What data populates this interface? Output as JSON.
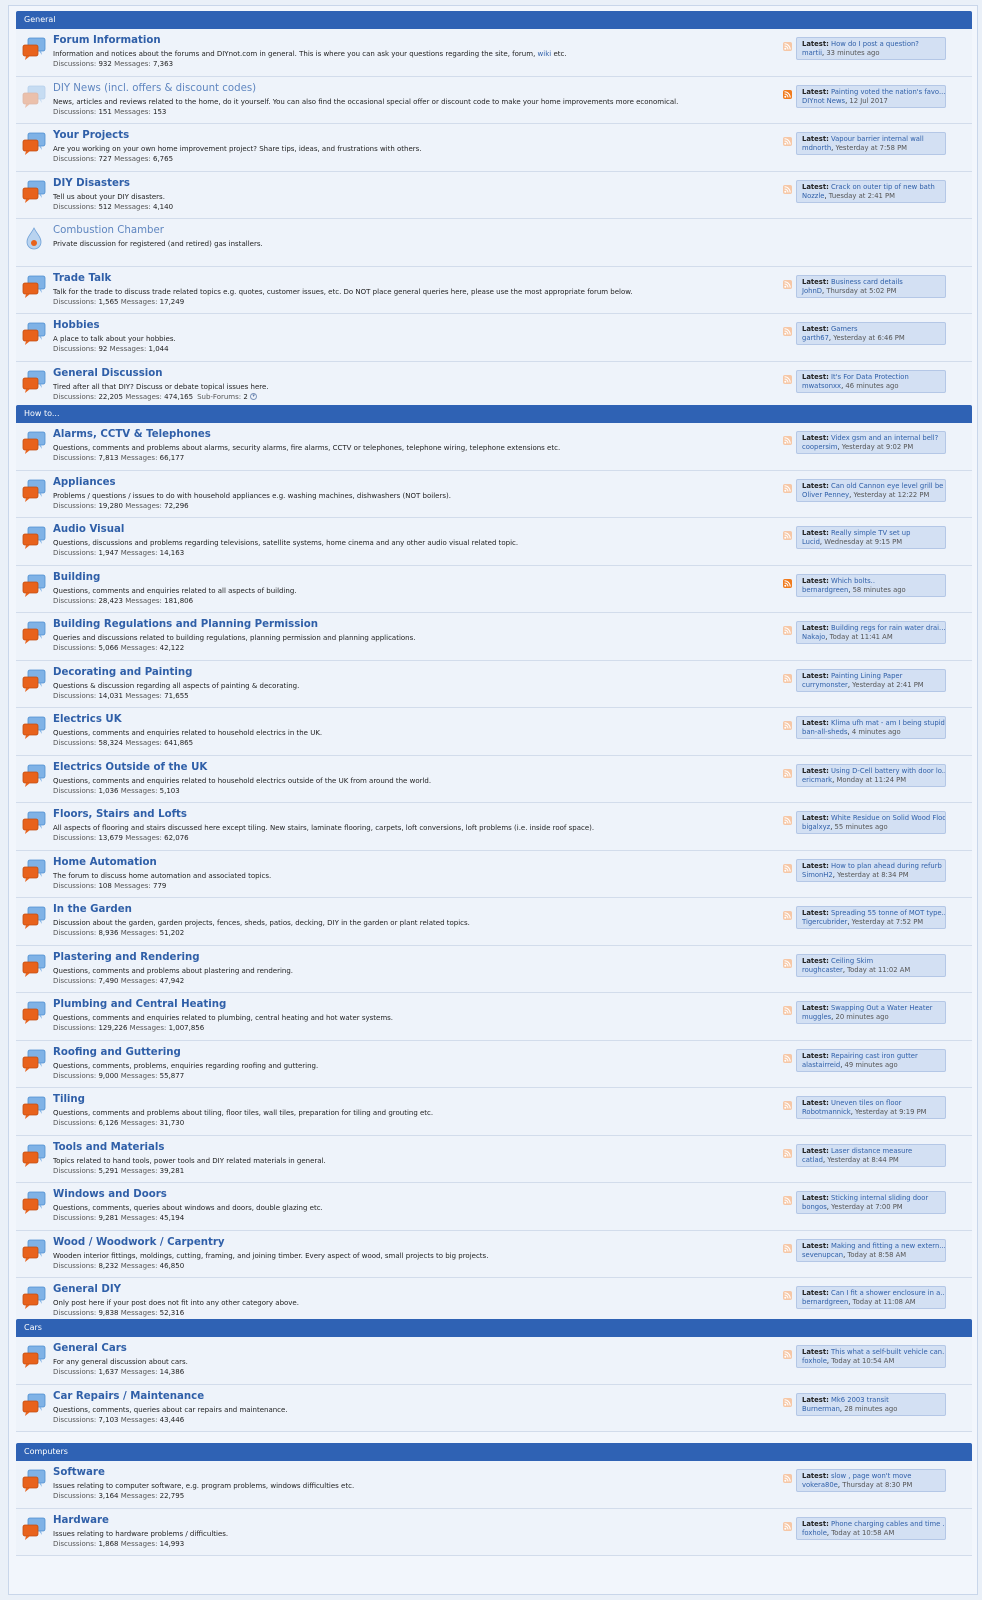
{
  "latest_label": "Latest:",
  "discussions_label": "Discussions:",
  "messages_label": "Messages:",
  "subforums_label": "Sub-Forums:",
  "colors": {
    "header_bg": "#2f62b4",
    "link": "#2f5fa8",
    "icon_orange": "#e8621c",
    "icon_blue": "#5b9bd9",
    "rss_active": "#f07b1e"
  },
  "categories": [
    {
      "title": "General",
      "forums": [
        {
          "title": "Forum Information",
          "desc": "Information and notices about the forums and DIYnot.com in general. This is where you can ask your questions regarding the site, forum,",
          "desc_link": "wiki",
          "desc_after": "etc.",
          "discussions": "932",
          "messages": "7,363",
          "latest_title": "How do I post a question?",
          "latest_user": "martii",
          "latest_time": "33 minutes ago",
          "icon": "chat",
          "rss": "inactive"
        },
        {
          "title": "DIY News (incl. offers & discount codes)",
          "desc": "News, articles and reviews related to the home, do it yourself. You can also find the occasional special offer or discount code to make your home improvements more economical.",
          "discussions": "151",
          "messages": "153",
          "latest_title": "Painting voted the nation's favo...",
          "latest_user": "DIYnot News",
          "latest_time": "12 Jul 2017",
          "icon": "chat-faded",
          "rss": "active",
          "dim": true
        },
        {
          "title": "Your Projects",
          "desc": "Are you working on your own home improvement project? Share tips, ideas, and frustrations with others.",
          "discussions": "727",
          "messages": "6,765",
          "latest_title": "Vapour barrier internal wall",
          "latest_user": "mdnorth",
          "latest_time": "Yesterday at 7:58 PM",
          "icon": "chat",
          "rss": "inactive"
        },
        {
          "title": "DIY Disasters",
          "desc": "Tell us about your DIY disasters.",
          "discussions": "512",
          "messages": "4,140",
          "latest_title": "Crack on outer tip of new bath",
          "latest_user": "Nozzle",
          "latest_time": "Tuesday at 2:41 PM",
          "icon": "chat",
          "rss": "inactive"
        },
        {
          "title": "Combustion Chamber",
          "desc": "Private discussion for registered (and retired) gas installers.",
          "icon": "flame",
          "dim": true,
          "no_stats": true
        },
        {
          "title": "Trade Talk",
          "desc": "Talk for the trade to discuss trade related topics e.g. quotes, customer issues, etc. Do NOT place general queries here, please use the most appropriate forum below.",
          "discussions": "1,565",
          "messages": "17,249",
          "latest_title": "Business card details",
          "latest_user": "JohnD",
          "latest_time": "Thursday at 5:02 PM",
          "icon": "chat",
          "rss": "inactive"
        },
        {
          "title": "Hobbies",
          "desc": "A place to talk about your hobbies.",
          "discussions": "92",
          "messages": "1,044",
          "latest_title": "Gamers",
          "latest_user": "garth67",
          "latest_time": "Yesterday at 6:46 PM",
          "icon": "chat",
          "rss": "inactive"
        },
        {
          "title": "General Discussion",
          "desc": "Tired after all that DIY? Discuss or debate topical issues here.",
          "discussions": "22,205",
          "messages": "474,165",
          "subforums": "2",
          "latest_title": "It's For Data Protection",
          "latest_user": "mwatsonxx",
          "latest_time": "46 minutes ago",
          "icon": "chat",
          "rss": "inactive"
        }
      ]
    },
    {
      "title": "How to...",
      "forums": [
        {
          "title": "Alarms, CCTV & Telephones",
          "desc": "Questions, comments and problems about alarms, security alarms, fire alarms, CCTV or telephones, telephone wiring, telephone extensions etc.",
          "discussions": "7,813",
          "messages": "66,177",
          "latest_title": "Videx gsm and an internal bell?",
          "latest_user": "coopersim",
          "latest_time": "Yesterday at 9:02 PM",
          "icon": "chat",
          "rss": "inactive"
        },
        {
          "title": "Appliances",
          "desc": "Problems / questions / issues to do with household appliances e.g. washing machines, dishwashers (NOT boilers).",
          "discussions": "19,280",
          "messages": "72,296",
          "latest_title": "Can old Cannon eye level grill be ...",
          "latest_user": "Oliver Penney",
          "latest_time": "Yesterday at 12:22 PM",
          "icon": "chat",
          "rss": "inactive"
        },
        {
          "title": "Audio Visual",
          "desc": "Questions, discussions and problems regarding televisions, satellite systems, home cinema and any other audio visual related topic.",
          "discussions": "1,947",
          "messages": "14,163",
          "latest_title": "Really simple TV set up",
          "latest_user": "Lucid",
          "latest_time": "Wednesday at 9:15 PM",
          "icon": "chat",
          "rss": "inactive"
        },
        {
          "title": "Building",
          "desc": "Questions, comments and enquiries related to all aspects of building.",
          "discussions": "28,423",
          "messages": "181,806",
          "latest_title": "Which bolts..",
          "latest_user": "bernardgreen",
          "latest_time": "58 minutes ago",
          "icon": "chat",
          "rss": "active"
        },
        {
          "title": "Building Regulations and Planning Permission",
          "desc": "Queries and discussions related to building regulations, planning permission and planning applications.",
          "discussions": "5,066",
          "messages": "42,122",
          "latest_title": "Building regs for rain water drai...",
          "latest_user": "Nakajo",
          "latest_time": "Today at 11:41 AM",
          "icon": "chat",
          "rss": "inactive"
        },
        {
          "title": "Decorating and Painting",
          "desc": "Questions & discussion regarding all aspects of painting & decorating.",
          "discussions": "14,031",
          "messages": "71,655",
          "latest_title": "Painting Lining Paper",
          "latest_user": "currymonster",
          "latest_time": "Yesterday at 2:41 PM",
          "icon": "chat",
          "rss": "inactive"
        },
        {
          "title": "Electrics UK",
          "desc": "Questions, comments and enquiries related to household electrics in the UK.",
          "discussions": "58,324",
          "messages": "641,865",
          "latest_title": "Klima ufh mat - am I being stupid...",
          "latest_user": "ban-all-sheds",
          "latest_time": "4 minutes ago",
          "icon": "chat",
          "rss": "inactive"
        },
        {
          "title": "Electrics Outside of the UK",
          "desc": "Questions, comments and enquiries related to household electrics outside of the UK from around the world.",
          "discussions": "1,036",
          "messages": "5,103",
          "latest_title": "Using D-Cell battery with door lo...",
          "latest_user": "ericmark",
          "latest_time": "Monday at 11:24 PM",
          "icon": "chat",
          "rss": "inactive"
        },
        {
          "title": "Floors, Stairs and Lofts",
          "desc": "All aspects of flooring and stairs discussed here except tiling. New stairs, laminate flooring, carpets, loft conversions, loft problems (i.e. inside roof space).",
          "discussions": "13,679",
          "messages": "62,076",
          "latest_title": "White Residue on Solid Wood Floor",
          "latest_user": "bigalxyz",
          "latest_time": "55 minutes ago",
          "icon": "chat",
          "rss": "inactive"
        },
        {
          "title": "Home Automation",
          "desc": "The forum to discuss home automation and associated topics.",
          "discussions": "108",
          "messages": "779",
          "latest_title": "How to plan ahead during refurb",
          "latest_user": "SimonH2",
          "latest_time": "Yesterday at 8:34 PM",
          "icon": "chat",
          "rss": "inactive"
        },
        {
          "title": "In the Garden",
          "desc": "Discussion about the garden, garden projects, fences, sheds, patios, decking, DIY in the garden or plant related topics.",
          "discussions": "8,936",
          "messages": "51,202",
          "latest_title": "Spreading 55 tonne of MOT type...",
          "latest_user": "Tigercubrider",
          "latest_time": "Yesterday at 7:52 PM",
          "icon": "chat",
          "rss": "inactive"
        },
        {
          "title": "Plastering and Rendering",
          "desc": "Questions, comments and problems about plastering and rendering.",
          "discussions": "7,490",
          "messages": "47,942",
          "latest_title": "Ceiling Skim",
          "latest_user": "roughcaster",
          "latest_time": "Today at 11:02 AM",
          "icon": "chat",
          "rss": "inactive"
        },
        {
          "title": "Plumbing and Central Heating",
          "desc": "Questions, comments and enquiries related to plumbing, central heating and hot water systems.",
          "discussions": "129,226",
          "messages": "1,007,856",
          "latest_title": "Swapping Out a Water Heater",
          "latest_user": "muggles",
          "latest_time": "20 minutes ago",
          "icon": "chat",
          "rss": "inactive"
        },
        {
          "title": "Roofing and Guttering",
          "desc": "Questions, comments, problems, enquiries regarding roofing and guttering.",
          "discussions": "9,000",
          "messages": "55,877",
          "latest_title": "Repairing cast iron gutter",
          "latest_user": "alastairreid",
          "latest_time": "49 minutes ago",
          "icon": "chat",
          "rss": "inactive"
        },
        {
          "title": "Tiling",
          "desc": "Questions, comments and problems about tiling, floor tiles, wall tiles, preparation for tiling and grouting etc.",
          "discussions": "6,126",
          "messages": "31,730",
          "latest_title": "Uneven tiles on floor",
          "latest_user": "Robotmannick",
          "latest_time": "Yesterday at 9:19 PM",
          "icon": "chat",
          "rss": "inactive"
        },
        {
          "title": "Tools and Materials",
          "desc": "Topics related to hand tools, power tools and DIY related materials in general.",
          "discussions": "5,291",
          "messages": "39,281",
          "latest_title": "Laser distance measure",
          "latest_user": "catlad",
          "latest_time": "Yesterday at 8:44 PM",
          "icon": "chat",
          "rss": "inactive"
        },
        {
          "title": "Windows and Doors",
          "desc": "Questions, comments, queries about windows and doors, double glazing etc.",
          "discussions": "9,281",
          "messages": "45,194",
          "latest_title": "Sticking internal sliding door",
          "latest_user": "bongos",
          "latest_time": "Yesterday at 7:00 PM",
          "icon": "chat",
          "rss": "inactive"
        },
        {
          "title": "Wood / Woodwork / Carpentry",
          "desc": "Wooden interior fittings, moldings, cutting, framing, and joining timber. Every aspect of wood, small projects to big projects.",
          "discussions": "8,232",
          "messages": "46,850",
          "latest_title": "Making and fitting a new extern...",
          "latest_user": "sevenupcan",
          "latest_time": "Today at 8:58 AM",
          "icon": "chat",
          "rss": "inactive"
        },
        {
          "title": "General DIY",
          "desc": "Only post here if your post does not fit into any other category above.",
          "discussions": "9,838",
          "messages": "52,316",
          "latest_title": "Can I fit a shower enclosure in a...",
          "latest_user": "bernardgreen",
          "latest_time": "Today at 11:08 AM",
          "icon": "chat",
          "rss": "inactive"
        }
      ]
    },
    {
      "title": "Cars",
      "forums": [
        {
          "title": "General Cars",
          "desc": "For any general discussion about cars.",
          "discussions": "1,637",
          "messages": "14,386",
          "latest_title": "This what a self-built vehicle can...",
          "latest_user": "foxhole",
          "latest_time": "Today at 10:54 AM",
          "icon": "chat",
          "rss": "inactive"
        },
        {
          "title": "Car Repairs / Maintenance",
          "desc": "Questions, comments, queries about car repairs and maintenance.",
          "discussions": "7,103",
          "messages": "43,446",
          "latest_title": "Mk6 2003 transit",
          "latest_user": "Burnerman",
          "latest_time": "28 minutes ago",
          "icon": "chat",
          "rss": "inactive"
        }
      ]
    },
    {
      "title": "Computers",
      "forums": [
        {
          "title": "Software",
          "desc": "Issues relating to computer software, e.g. program problems, windows difficulties etc.",
          "discussions": "3,164",
          "messages": "22,795",
          "latest_title": "slow , page won't move",
          "latest_user": "vokera80e",
          "latest_time": "Thursday at 8:30 PM",
          "icon": "chat",
          "rss": "inactive"
        },
        {
          "title": "Hardware",
          "desc": "Issues relating to hardware problems / difficulties.",
          "discussions": "1,868",
          "messages": "14,993",
          "latest_title": "Phone charging cables and time ...",
          "latest_user": "foxhole",
          "latest_time": "Today at 10:58 AM",
          "icon": "chat",
          "rss": "inactive"
        }
      ]
    }
  ]
}
